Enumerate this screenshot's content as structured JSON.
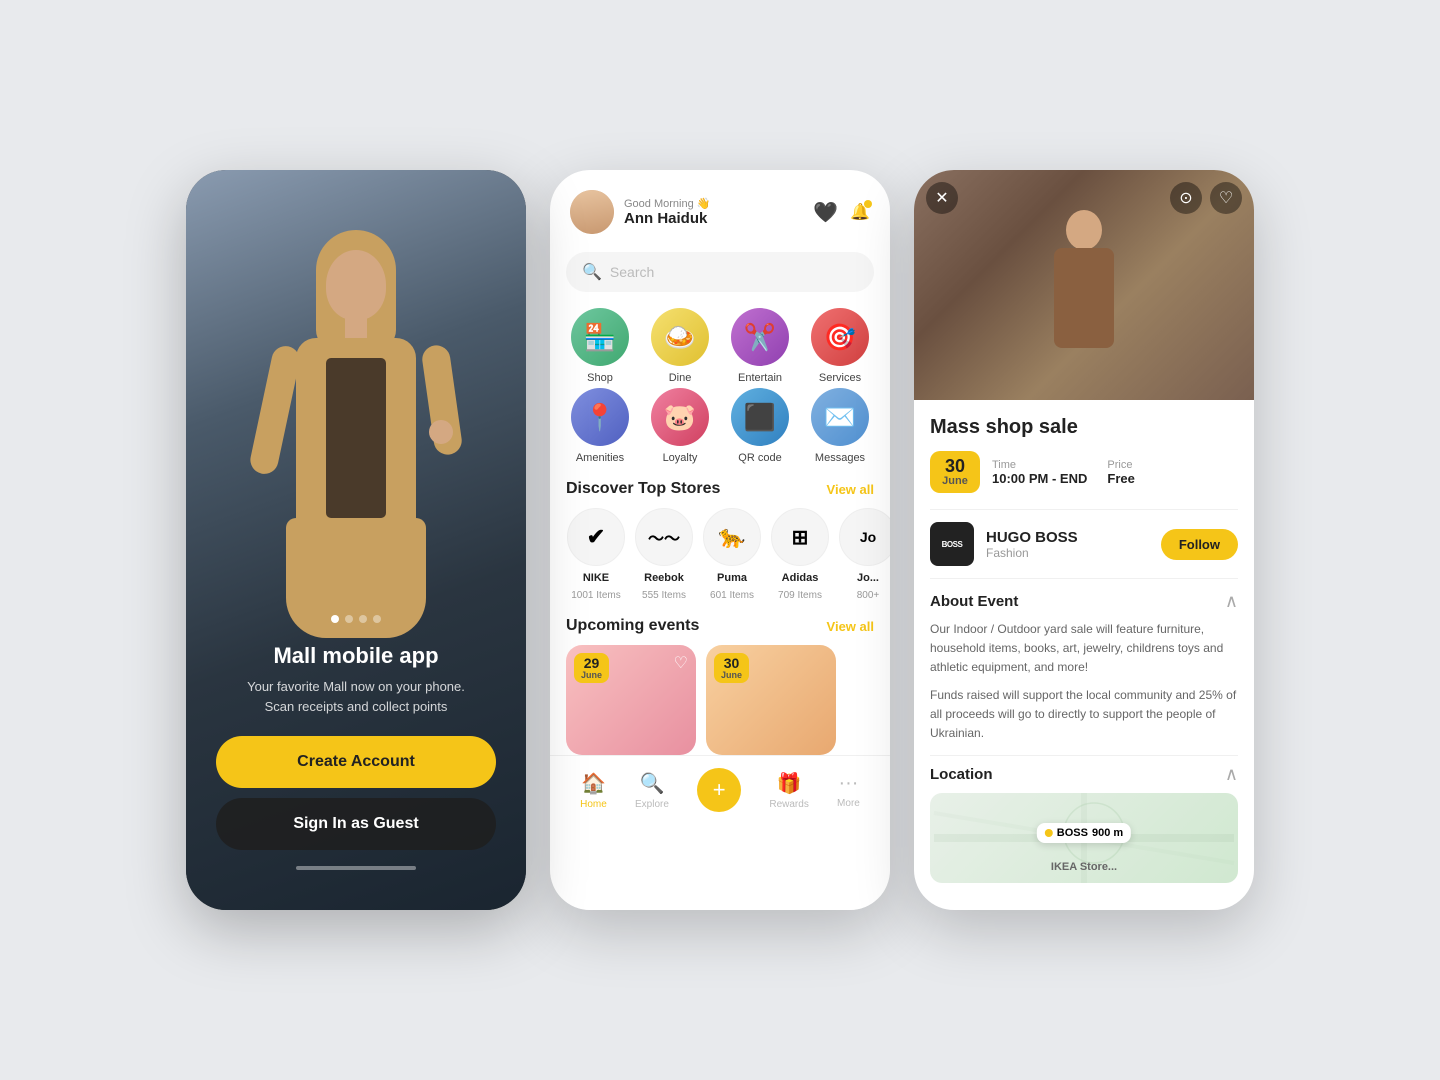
{
  "app": {
    "background": "#e8eaed"
  },
  "phone_login": {
    "title": "Mall mobile app",
    "subtitle": "Your favorite Mall now on your phone. Scan receipts and collect points",
    "create_account_btn": "Create Account",
    "guest_btn": "Sign In as Guest",
    "dots": [
      "active",
      "inactive",
      "inactive",
      "inactive"
    ]
  },
  "phone_home": {
    "greeting": "Good Morning 👋",
    "user_name": "Ann Haiduk",
    "search_placeholder": "Search",
    "categories": [
      {
        "label": "Shop",
        "icon": "🏪",
        "style": "cat-shop"
      },
      {
        "label": "Dine",
        "icon": "🍽️",
        "style": "cat-dine"
      },
      {
        "label": "Entertain",
        "icon": "✂️",
        "style": "cat-entertain"
      },
      {
        "label": "Services",
        "icon": "🎯",
        "style": "cat-services"
      },
      {
        "label": "Amenities",
        "icon": "📍",
        "style": "cat-amenities"
      },
      {
        "label": "Loyalty",
        "icon": "🐷",
        "style": "cat-loyalty"
      },
      {
        "label": "QR code",
        "icon": "📷",
        "style": "cat-qr"
      },
      {
        "label": "Messages",
        "icon": "✉️",
        "style": "cat-messages"
      }
    ],
    "discover_title": "Discover Top Stores",
    "view_all_stores": "View all",
    "stores": [
      {
        "name": "NIKE",
        "items": "1001 Items",
        "logo": "✔"
      },
      {
        "name": "Reebok",
        "items": "555 Items",
        "logo": "≈"
      },
      {
        "name": "Puma",
        "items": "601 Items",
        "logo": "🐆"
      },
      {
        "name": "Adidas",
        "items": "709 Items",
        "logo": "⊞"
      },
      {
        "name": "Jo...",
        "items": "800+",
        "logo": "J"
      }
    ],
    "events_title": "Upcoming events",
    "view_all_events": "View all",
    "events": [
      {
        "day": "29",
        "month": "June",
        "bg": "pink"
      },
      {
        "day": "30",
        "month": "June",
        "bg": "peach"
      }
    ],
    "nav": [
      {
        "label": "Home",
        "icon": "🏠",
        "active": true
      },
      {
        "label": "Explore",
        "icon": "🔍",
        "active": false
      },
      {
        "label": "",
        "icon": "+",
        "add": true
      },
      {
        "label": "Rewards",
        "icon": "🎁",
        "active": false
      },
      {
        "label": "More",
        "icon": "···",
        "active": false
      }
    ]
  },
  "phone_detail": {
    "event_title": "Mass shop sale",
    "date_day": "30",
    "date_month": "June",
    "time_label": "Time",
    "time_value": "10:00 PM - END",
    "price_label": "Price",
    "price_value": "Free",
    "brand_name": "HUGO BOSS",
    "brand_type": "Fashion",
    "follow_btn": "Follow",
    "about_title": "About Event",
    "about_text_1": "Our Indoor / Outdoor yard sale will feature furniture, household items, books, art, jewelry, childrens toys and athletic equipment, and more!",
    "about_text_2": "Funds raised will support the local community and 25% of all proceeds will go to directly to support the people of Ukrainian.",
    "location_title": "Location",
    "map_label": "BOSS",
    "map_distance": "900 m",
    "ikea_label": "IKEA Store..."
  }
}
